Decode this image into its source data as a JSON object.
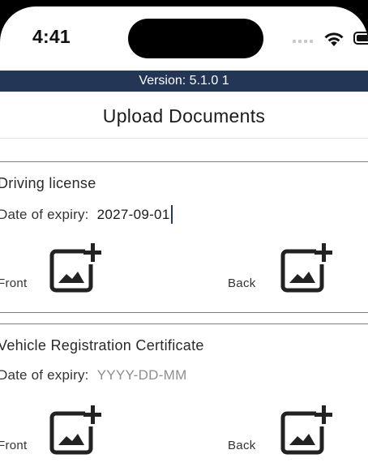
{
  "status_bar": {
    "time": "4:41"
  },
  "version_bar": {
    "text": "Version: 5.1.0 1"
  },
  "header": {
    "back_icon": "chevron-left-icon",
    "title": "Upload Documents"
  },
  "documents": [
    {
      "title": "Driving license",
      "expiry_label": "Date of expiry:",
      "expiry_value": "2027-09-01",
      "expiry_placeholder": "",
      "front_label": "Front",
      "back_label": "Back",
      "upload_icon": "add-photo-icon"
    },
    {
      "title": "Vehicle Registration Certificate",
      "expiry_label": "Date of expiry:",
      "expiry_value": "",
      "expiry_placeholder": "YYYY-DD-MM",
      "front_label": "Front",
      "back_label": "Back",
      "upload_icon": "add-photo-icon"
    }
  ],
  "colors": {
    "version_bar_bg": "#233656",
    "caret": "#223a6a"
  }
}
